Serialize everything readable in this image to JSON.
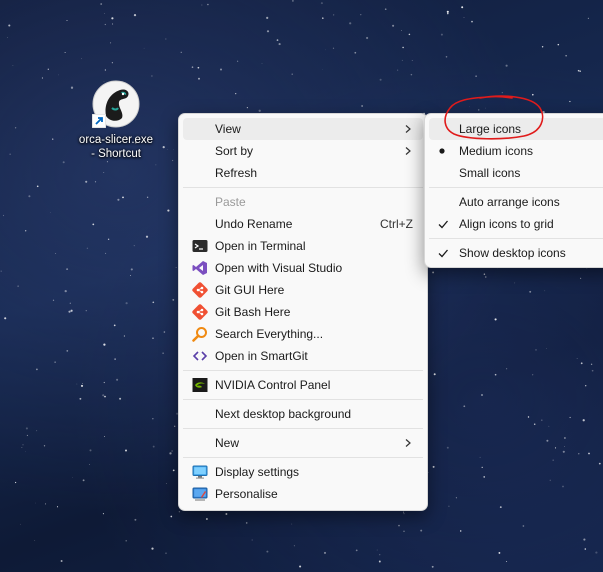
{
  "desktop": {
    "shortcut": {
      "label": "orca-slicer.exe - Shortcut",
      "icon": "orca-slicer-icon"
    }
  },
  "context_menu": {
    "view": "View",
    "sort_by": "Sort by",
    "refresh": "Refresh",
    "paste": "Paste",
    "undo_rename": "Undo Rename",
    "undo_shortcut": "Ctrl+Z",
    "open_terminal": "Open in Terminal",
    "open_vs": "Open with Visual Studio",
    "git_gui": "Git GUI Here",
    "git_bash": "Git Bash Here",
    "search_everything": "Search Everything...",
    "smartgit": "Open in SmartGit",
    "nvidia": "NVIDIA Control Panel",
    "next_bg": "Next desktop background",
    "new": "New",
    "display_settings": "Display settings",
    "personalise": "Personalise"
  },
  "view_submenu": {
    "large_icons": "Large icons",
    "medium_icons": "Medium icons",
    "small_icons": "Small icons",
    "auto_arrange": "Auto arrange icons",
    "align_grid": "Align icons to grid",
    "show_desktop_icons": "Show desktop icons",
    "selected_size": "Medium icons",
    "checked": [
      "Align icons to grid",
      "Show desktop icons"
    ]
  },
  "colors": {
    "annotation": "#e01b1b",
    "vs_purple": "#7b4fc0",
    "git_orange": "#f05033",
    "nvidia_green": "#76b900"
  }
}
